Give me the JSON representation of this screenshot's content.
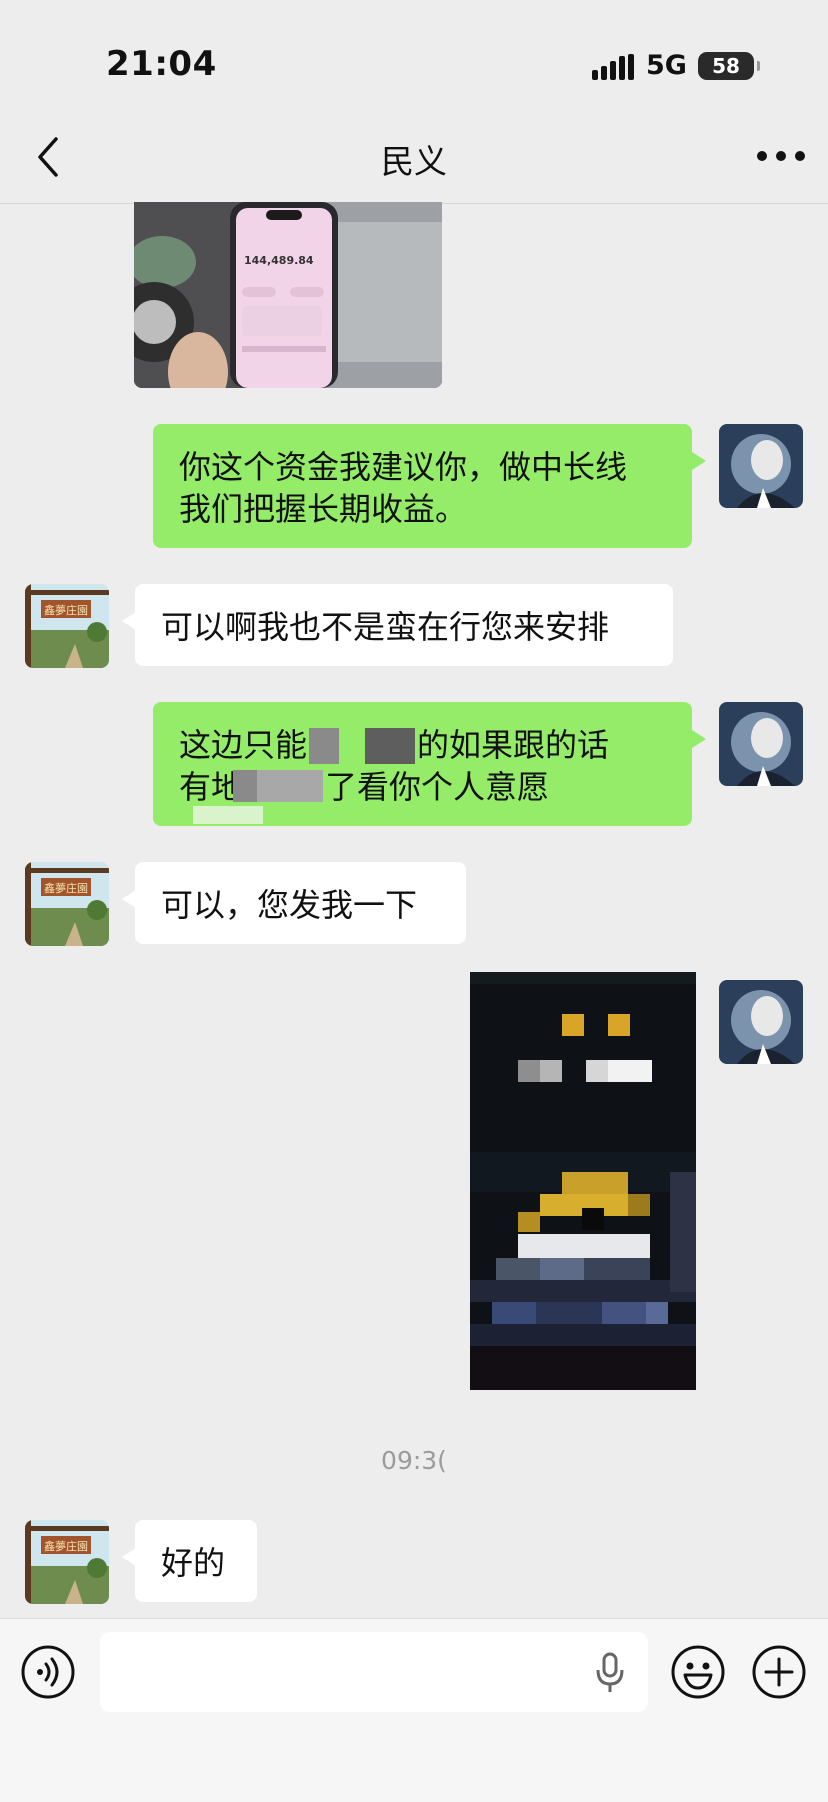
{
  "status_bar": {
    "time": "21:04",
    "network": "5G",
    "battery": "58"
  },
  "nav": {
    "title": "民义"
  },
  "messages": [
    {
      "from": "other",
      "type": "image",
      "description_icon": "phone-photo"
    },
    {
      "from": "me",
      "type": "text",
      "lines": [
        "你这个资金我建议你，做中长线",
        "我们把握长期收益。"
      ]
    },
    {
      "from": "other",
      "type": "text",
      "text": "可以啊我也不是蛮在行您来安排"
    },
    {
      "from": "me",
      "type": "text",
      "lines": [
        "这边只能",
        "的如果跟的话",
        "有地",
        "了看你个人意愿"
      ]
    },
    {
      "from": "other",
      "type": "text",
      "text": "可以，您发我一下"
    },
    {
      "from": "me",
      "type": "image",
      "description_icon": "pixelated-image"
    },
    {
      "from": "other",
      "type": "text",
      "text": "好的"
    }
  ],
  "timestamp": "09:3(",
  "photo": {
    "amount": "144,489.84"
  },
  "colors": {
    "my_bubble": "#95ec69",
    "their_bubble": "#ffffff",
    "background": "#ededed"
  }
}
